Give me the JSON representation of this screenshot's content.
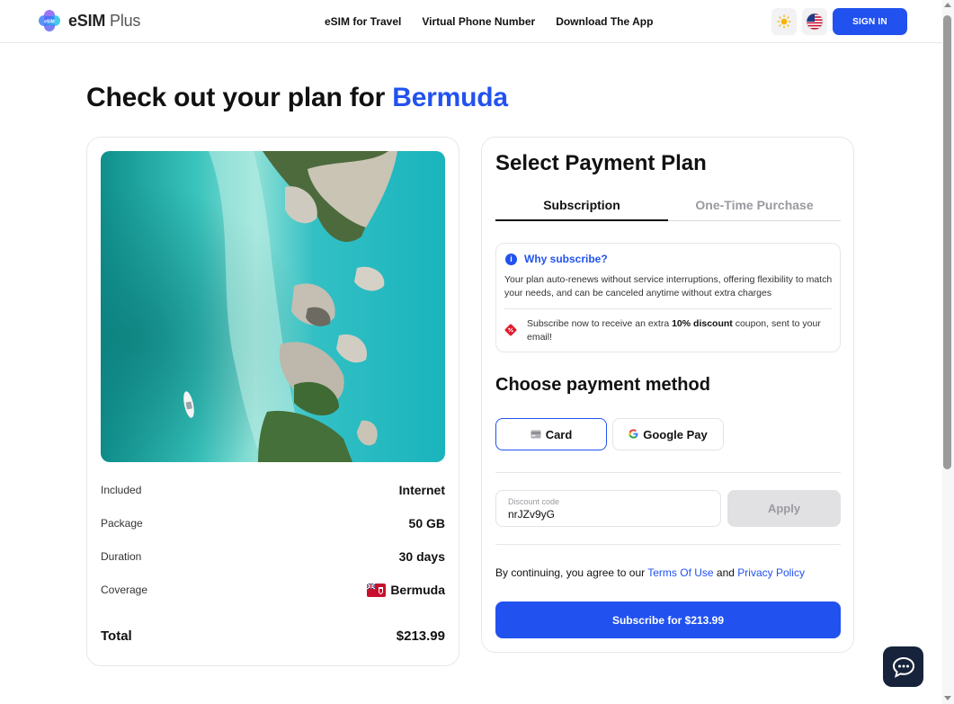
{
  "header": {
    "logo_bold": "eSIM",
    "logo_light": " Plus",
    "nav": [
      "eSIM for Travel",
      "Virtual Phone Number",
      "Download The App"
    ],
    "theme_icon": "sun-icon",
    "language_icon": "us-flag-icon",
    "signin_label": "SIGN IN"
  },
  "page": {
    "title_prefix": "Check out your plan for ",
    "country": "Bermuda"
  },
  "plan": {
    "image_alt": "aerial-coast-image",
    "rows": [
      {
        "label": "Included",
        "value": "Internet"
      },
      {
        "label": "Package",
        "value": "50 GB"
      },
      {
        "label": "Duration",
        "value": "30 days"
      },
      {
        "label": "Coverage",
        "value": "Bermuda"
      }
    ],
    "total_label": "Total",
    "total_value": "$213.99"
  },
  "payment": {
    "title": "Select Payment Plan",
    "tabs": [
      {
        "label": "Subscription",
        "active": true
      },
      {
        "label": "One-Time Purchase",
        "active": false
      }
    ],
    "why": {
      "title": "Why subscribe?",
      "text": "Your plan auto-renews without service interruptions, offering flexibility to match your needs, and can be canceled anytime without extra charges",
      "promo_before": "Subscribe now to receive an extra ",
      "promo_bold": "10% discount",
      "promo_after": " coupon, sent to your email!"
    },
    "method_title": "Choose payment method",
    "methods": [
      {
        "label": "Card",
        "icon": "card-icon",
        "selected": true
      },
      {
        "label": "Google Pay",
        "icon": "google-icon",
        "selected": false
      }
    ],
    "discount": {
      "label": "Discount code",
      "value": "nrJZv9yG",
      "apply_label": "Apply"
    },
    "terms_before": "By continuing, you agree to our ",
    "terms_link": "Terms Of Use",
    "terms_middle": " and ",
    "privacy_link": "Privacy Policy",
    "subscribe_label": "Subscribe for $213.99"
  },
  "colors": {
    "accent": "#2152ef",
    "chat_bg": "#16233b"
  }
}
